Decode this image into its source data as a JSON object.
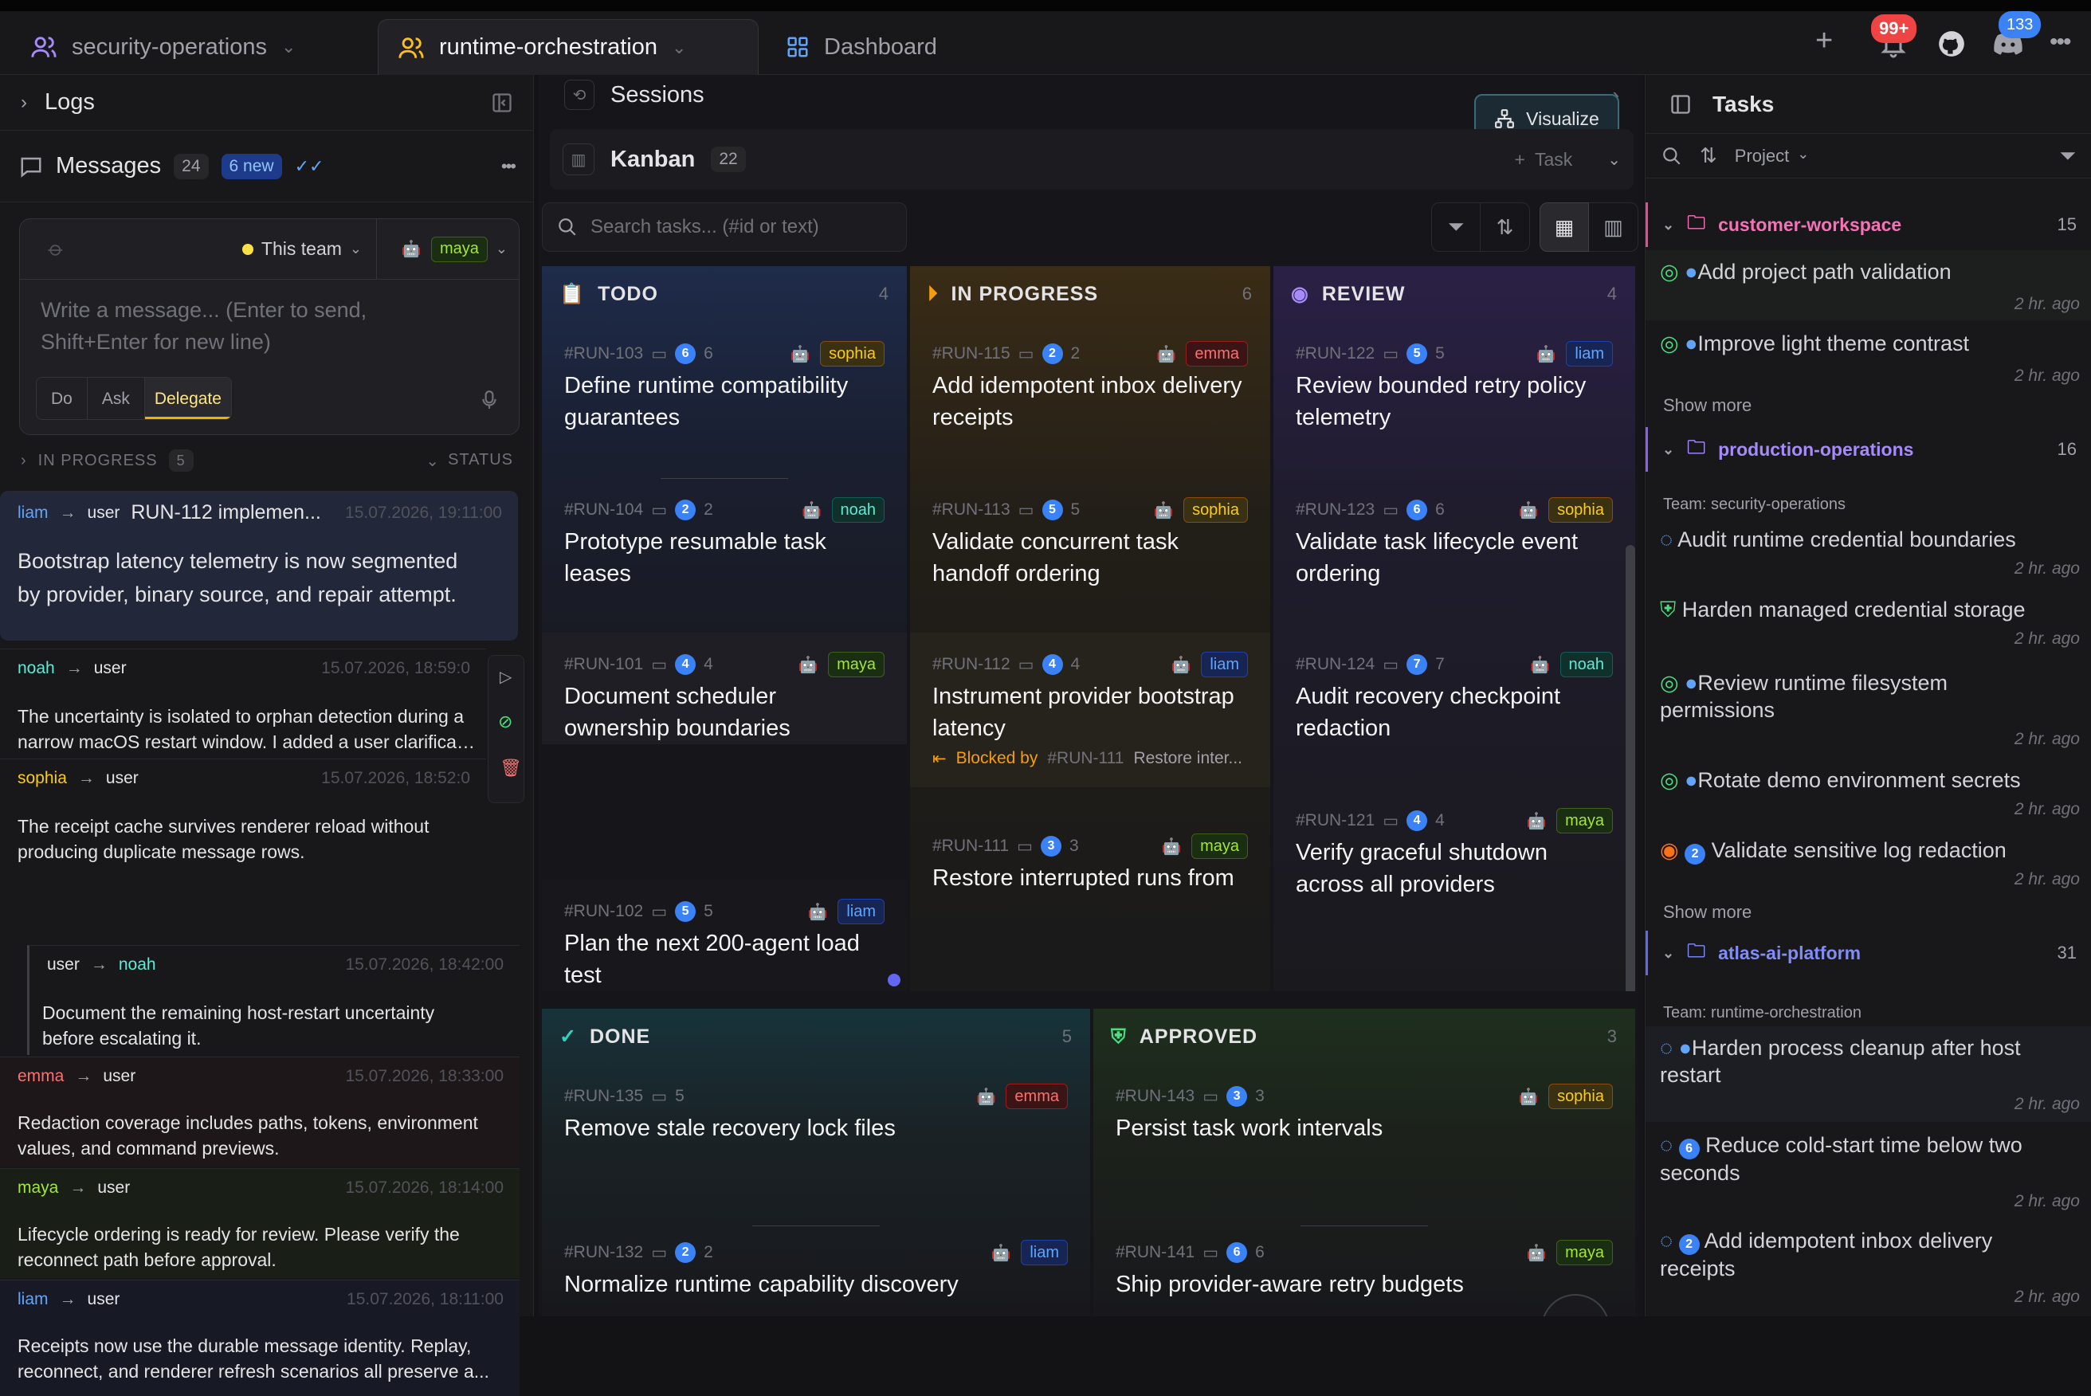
{
  "tabs": {
    "t1": "security-operations",
    "t2": "runtime-orchestration",
    "t3": "Dashboard",
    "notif_count": "99+",
    "discord_count": "133"
  },
  "left": {
    "logs": "Logs",
    "messages": "Messages",
    "msg_count": "24",
    "new_count": "6 new",
    "scope": "This team",
    "assignee": "maya",
    "placeholder1": "Write a message... (Enter to send,",
    "placeholder2": "Shift+Enter for new line)",
    "modes": [
      "Do",
      "Ask",
      "Delegate"
    ],
    "in_progress": "IN PROGRESS",
    "in_progress_count": "5",
    "status": "STATUS",
    "arrow": "→",
    "messages_list": [
      {
        "from": "liam",
        "to": "user",
        "subject": "RUN-112 implemen...",
        "time": "15.07.2026, 19:11:00",
        "line1": "Bootstrap latency telemetry is now segmented",
        "line2": "by provider, binary source, and repair attempt."
      },
      {
        "from": "noah",
        "to": "user",
        "time": "15.07.2026, 18:59:0",
        "line1": "The uncertainty is isolated to orphan detection during a",
        "line2": "narrow macOS restart window. I added a user clarificatio"
      },
      {
        "from": "sophia",
        "to": "user",
        "time": "15.07.2026, 18:52:0",
        "line1": "The receipt cache survives renderer reload without",
        "line2": "producing duplicate message rows."
      },
      {
        "from": "user",
        "to": "noah",
        "time": "15.07.2026, 18:42:00",
        "line1": "Document the remaining host-restart uncertainty",
        "line2": "before escalating it."
      },
      {
        "from": "emma",
        "to": "user",
        "time": "15.07.2026, 18:33:00",
        "line1": "Redaction coverage includes paths, tokens, environment",
        "line2": "values, and command previews."
      },
      {
        "from": "maya",
        "to": "user",
        "time": "15.07.2026, 18:14:00",
        "line1": "Lifecycle ordering is ready for review. Please verify the",
        "line2": "reconnect path before approval."
      },
      {
        "from": "liam",
        "to": "user",
        "time": "15.07.2026, 18:11:00",
        "line1": "Receipts now use the durable message identity. Replay,",
        "line2": "reconnect, and renderer refresh scenarios all preserve a..."
      }
    ]
  },
  "center": {
    "sessions": "Sessions",
    "visualize": "Visualize",
    "kanban": "Kanban",
    "kanban_count": "22",
    "task_btn": "Task",
    "search_placeholder": "Search tasks... (#id or text)",
    "blocked_by": "Blocked by",
    "blocked_ref": "#RUN-111",
    "blocked_text": "Restore inter...",
    "columns": [
      {
        "name": "TODO",
        "count": "4",
        "accent": "#60a5fa",
        "cards": [
          {
            "id": "#RUN-103",
            "comments": "6",
            "user": "sophia",
            "title1": "Define runtime compatibility",
            "title2": "guarantees"
          },
          {
            "id": "#RUN-104",
            "comments": "2",
            "user": "noah",
            "title1": "Prototype resumable task",
            "title2": "leases"
          },
          {
            "id": "#RUN-101",
            "comments": "4",
            "user": "maya",
            "title1": "Document scheduler",
            "title2": "ownership boundaries"
          },
          {
            "id": "#RUN-102",
            "comments": "5",
            "user": "liam",
            "title1": "Plan the next 200-agent load",
            "title2": "test"
          }
        ]
      },
      {
        "name": "IN PROGRESS",
        "count": "6",
        "accent": "#f59e0b",
        "cards": [
          {
            "id": "#RUN-115",
            "comments": "2",
            "user": "emma",
            "title1": "Add idempotent inbox delivery",
            "title2": "receipts"
          },
          {
            "id": "#RUN-113",
            "comments": "5",
            "user": "sophia",
            "title1": "Validate concurrent task",
            "title2": "handoff ordering"
          },
          {
            "id": "#RUN-112",
            "comments": "4",
            "user": "liam",
            "title1": "Instrument provider bootstrap",
            "title2": "latency"
          },
          {
            "id": "#RUN-111",
            "comments": "3",
            "user": "maya",
            "title1": "Restore interrupted runs from",
            "title2": ""
          }
        ]
      },
      {
        "name": "REVIEW",
        "count": "4",
        "accent": "#a78bfa",
        "cards": [
          {
            "id": "#RUN-122",
            "comments": "5",
            "user": "liam",
            "title1": "Review bounded retry policy",
            "title2": "telemetry"
          },
          {
            "id": "#RUN-123",
            "comments": "6",
            "user": "sophia",
            "title1": "Validate task lifecycle event",
            "title2": "ordering"
          },
          {
            "id": "#RUN-124",
            "comments": "7",
            "user": "noah",
            "title1": "Audit recovery checkpoint",
            "title2": "redaction"
          },
          {
            "id": "#RUN-121",
            "comments": "4",
            "user": "maya",
            "title1": "Verify graceful shutdown",
            "title2": "across all providers"
          }
        ]
      },
      {
        "name": "DONE",
        "count": "5",
        "accent": "#2dd4bf",
        "cards": [
          {
            "id": "#RUN-135",
            "comments": "5",
            "user": "emma",
            "title1": "Remove stale recovery lock files",
            "title2": ""
          },
          {
            "id": "#RUN-132",
            "comments": "2",
            "user": "liam",
            "title1": "Normalize runtime capability discovery",
            "title2": ""
          }
        ]
      },
      {
        "name": "APPROVED",
        "count": "3",
        "accent": "#4ade80",
        "cards": [
          {
            "id": "#RUN-143",
            "comments": "3",
            "user": "sophia",
            "title1": "Persist task work intervals",
            "title2": ""
          },
          {
            "id": "#RUN-141",
            "comments": "6",
            "user": "maya",
            "title1": "Ship provider-aware retry budgets",
            "title2": ""
          }
        ]
      }
    ]
  },
  "right": {
    "title": "Tasks",
    "project": "Project",
    "show_more": "Show more",
    "ago": "2 hr. ago",
    "groups": [
      {
        "name": "customer-workspace",
        "count": "15",
        "team": ""
      },
      {
        "name": "production-operations",
        "count": "16",
        "team": "Team: security-operations"
      },
      {
        "name": "atlas-ai-platform",
        "count": "31",
        "team": "Team: runtime-orchestration"
      }
    ],
    "tasks": [
      "Add project path validation",
      "Improve light theme contrast",
      "Audit runtime credential boundaries",
      "Harden managed credential storage",
      "Review runtime filesystem",
      "permissions",
      "Rotate demo environment secrets",
      "Validate sensitive log redaction",
      "Harden process cleanup after host",
      "restart",
      "Reduce cold-start time below two",
      "seconds",
      "Add idempotent inbox delivery",
      "receipts"
    ],
    "badges": [
      "2",
      "6",
      "2"
    ]
  },
  "colors": {
    "sophia": "#facc15",
    "emma": "#f87171",
    "noah": "#5eead4",
    "liam": "#60a5fa",
    "maya": "#a3e635"
  }
}
